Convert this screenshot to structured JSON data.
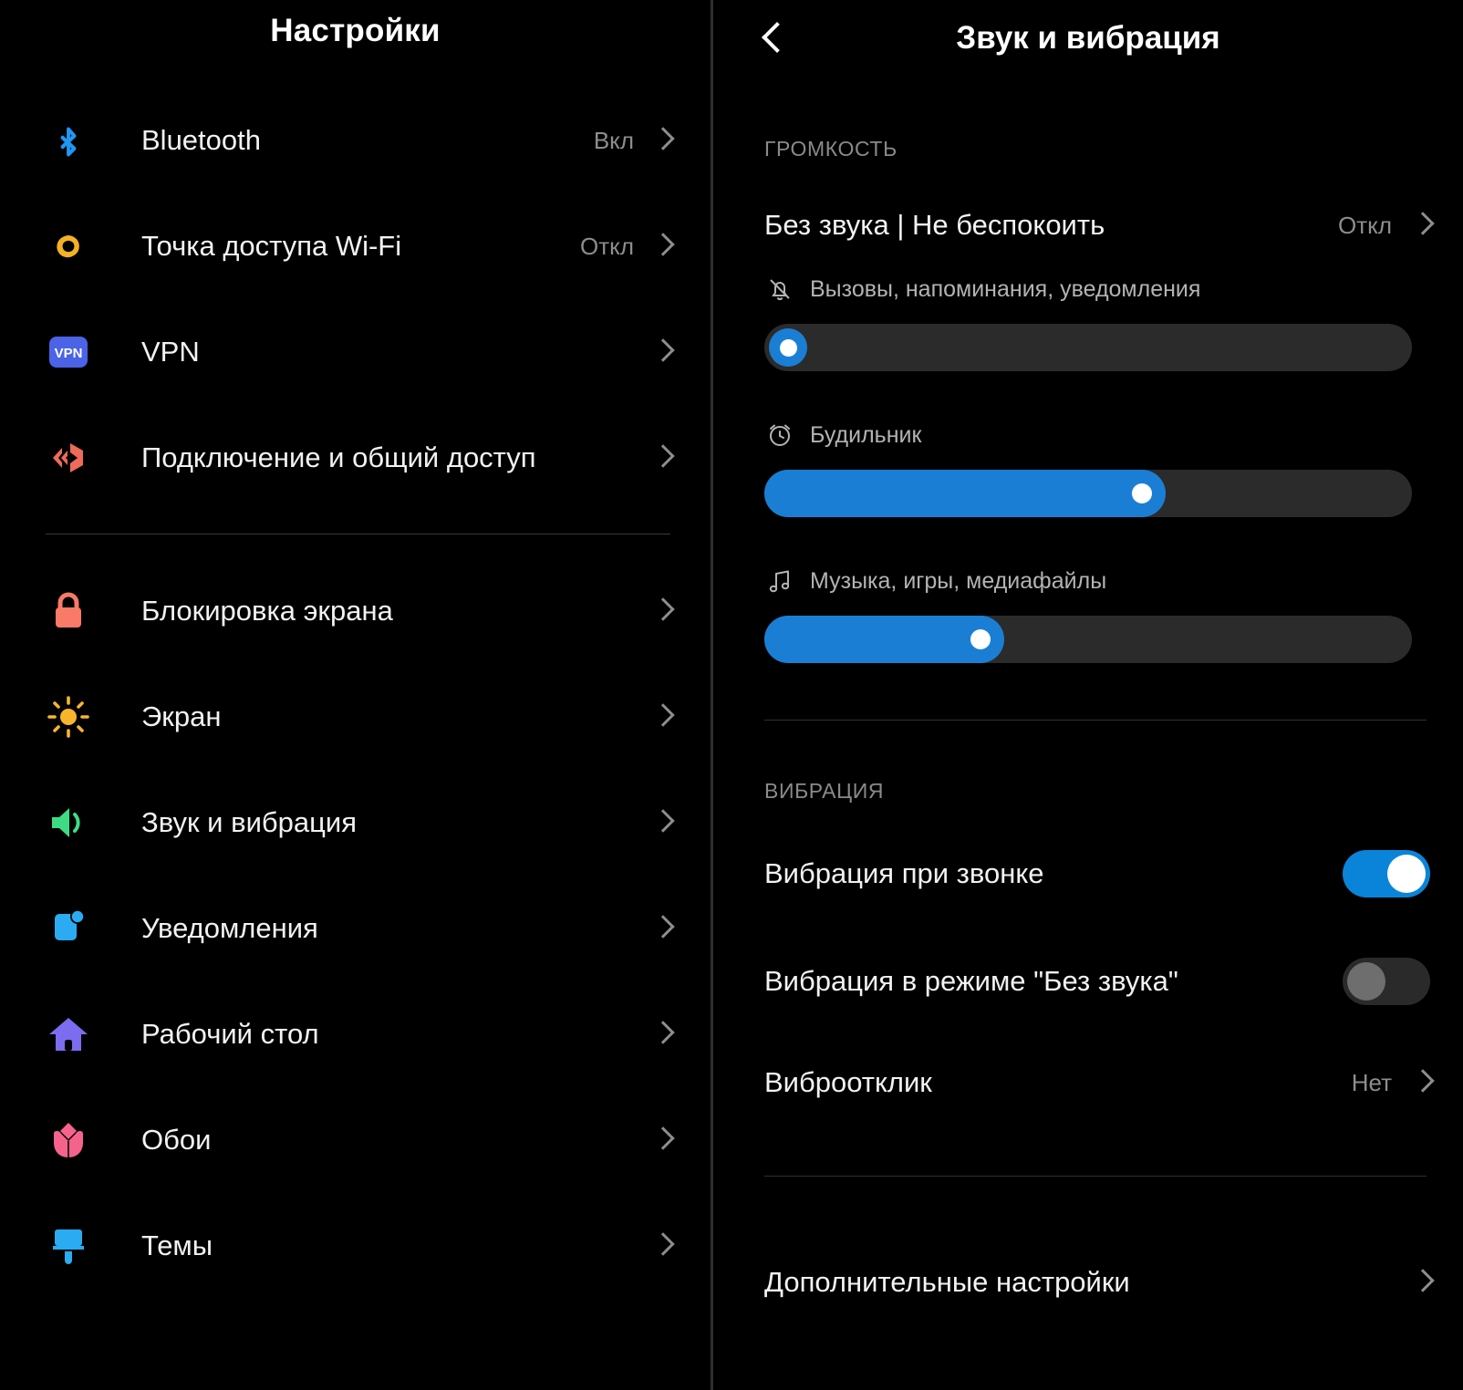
{
  "left_panel": {
    "title": "Настройки",
    "groups": [
      {
        "items": [
          {
            "icon": "bluetooth-icon",
            "label": "Bluetooth",
            "value": "Вкл"
          },
          {
            "icon": "wifi-hotspot-icon",
            "label": "Точка доступа Wi-Fi",
            "value": "Откл"
          },
          {
            "icon": "vpn-icon",
            "label": "VPN",
            "value": ""
          },
          {
            "icon": "connection-sharing-icon",
            "label": "Подключение и общий доступ",
            "value": ""
          }
        ]
      },
      {
        "items": [
          {
            "icon": "lock-icon",
            "label": "Блокировка экрана",
            "value": ""
          },
          {
            "icon": "brightness-sun-icon",
            "label": "Экран",
            "value": ""
          },
          {
            "icon": "speaker-icon",
            "label": "Звук и вибрация",
            "value": ""
          },
          {
            "icon": "notification-icon",
            "label": "Уведомления",
            "value": ""
          },
          {
            "icon": "home-icon",
            "label": "Рабочий стол",
            "value": ""
          },
          {
            "icon": "wallpaper-flower-icon",
            "label": "Обои",
            "value": ""
          },
          {
            "icon": "themes-brush-icon",
            "label": "Темы",
            "value": ""
          }
        ]
      }
    ]
  },
  "right_panel": {
    "title": "Звук и вибрация",
    "back_icon": "chevron-left-icon",
    "volume_section": {
      "heading": "ГРОМКОСТЬ",
      "dnd": {
        "label": "Без звука | Не беспокоить",
        "value": "Откл"
      },
      "sliders": [
        {
          "icon": "bell-off-icon",
          "label": "Вызовы, напоминания, уведомления",
          "percent": 0
        },
        {
          "icon": "alarm-clock-icon",
          "label": "Будильник",
          "percent": 62
        },
        {
          "icon": "music-note-icon",
          "label": "Музыка, игры, медиафайлы",
          "percent": 37
        }
      ]
    },
    "vibration_section": {
      "heading": "ВИБРАЦИЯ",
      "toggles": [
        {
          "label": "Вибрация при звонке",
          "state": "on"
        },
        {
          "label": "Вибрация в режиме \"Без звука\"",
          "state": "off"
        }
      ],
      "haptic": {
        "label": "Виброотклик",
        "value": "Нет"
      }
    },
    "more_settings": {
      "label": "Дополнительные настройки"
    }
  },
  "colors": {
    "accent_blue": "#1a7fd4",
    "toggle_on": "#0a84d8",
    "bluetooth": "#2196f3",
    "hotspot": "#f5b123",
    "vpn": "#4a63e7",
    "sharing": "#ee6a59",
    "lock": "#f97a66",
    "sun": "#f7b52c",
    "speaker": "#3ddc84",
    "notification": "#2aabf2",
    "home": "#7b6cf0",
    "flower": "#f5638c",
    "brush": "#2aabf2"
  }
}
